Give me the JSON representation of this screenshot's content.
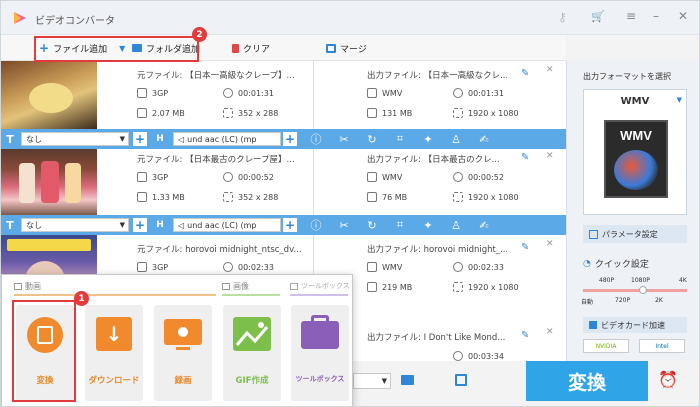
{
  "app": {
    "title": "ビデオコンバータ"
  },
  "toolbar": {
    "add_file": "ファイル追加",
    "add_folder": "フォルダ追加",
    "clear": "クリア",
    "merge": "マージ"
  },
  "files": [
    {
      "src_name": "元ファイル: 【日本一高級なクレープ】...",
      "src_format": "3GP",
      "src_duration": "00:01:31",
      "src_size": "2.07 MB",
      "src_res": "352 x 288",
      "out_name": "出力ファイル: 【日本一高級なクレ...",
      "out_format": "WMV",
      "out_duration": "00:01:31",
      "out_size": "131 MB",
      "out_res": "1920 x 1080"
    },
    {
      "src_name": "元ファイル: 【日本最古のクレープ屋】...",
      "src_format": "3GP",
      "src_duration": "00:00:52",
      "src_size": "1.33 MB",
      "src_res": "352 x 288",
      "out_name": "出力ファイル: 【日本最古のクレ...",
      "out_format": "WMV",
      "out_duration": "00:00:52",
      "out_size": "76 MB",
      "out_res": "1920 x 1080"
    },
    {
      "src_name": "元ファイル: horovoi midnight_ntsc_dv...",
      "src_format": "3GP",
      "src_duration": "00:02:33",
      "src_size": "",
      "src_res": "",
      "out_name": "出力ファイル: horovoi midnight_...",
      "out_format": "WMV",
      "out_duration": "00:02:33",
      "out_size": "219 MB",
      "out_res": "1920 x 1080"
    },
    {
      "src_name": "",
      "src_format": "",
      "src_duration": "",
      "src_size": "",
      "src_res": "",
      "out_name": "出力ファイル: I Don't Like Mond...",
      "out_format": "",
      "out_duration": "00:03:34",
      "out_size": "",
      "out_res": ""
    }
  ],
  "editbar": {
    "subtitle": "なし",
    "audio": "und aac (LC) (mp"
  },
  "right": {
    "format_title": "出力フォーマットを選択",
    "format_value": "WMV",
    "format_image_text": "WMV",
    "params": "パラメータ設定",
    "quick": "クイック設定",
    "q_top": [
      "480P",
      "1080P",
      "4K"
    ],
    "q_bottom": [
      "自動",
      "720P",
      "2K"
    ],
    "accel": "ビデオカード加速",
    "nvidia": "NVIDIA",
    "intel": "Intel"
  },
  "convert": "変換",
  "popup": {
    "sec_video": "動画",
    "sec_image": "画像",
    "sec_toolbox": "ツールボックス",
    "tiles": [
      "変換",
      "ダウンロード",
      "録画",
      "GIF作成",
      "ツールボックス"
    ]
  },
  "badges": {
    "b1": "1",
    "b2": "2"
  },
  "colors": {
    "accent": "#2fa4e7",
    "bar": "#5ba9e6",
    "orange": "#f08a2c",
    "green": "#7cc04b",
    "purple": "#8a5fb8",
    "red": "#e23b3b"
  }
}
